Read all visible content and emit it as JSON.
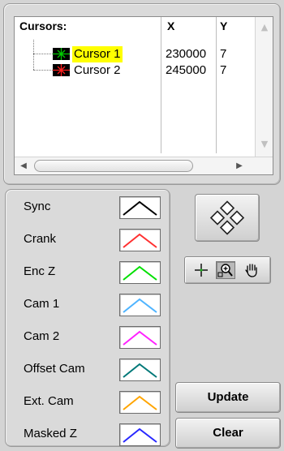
{
  "cursor_table": {
    "headers": {
      "name": "Cursors:",
      "x": "X",
      "y": "Y"
    },
    "rows": [
      {
        "name": "Cursor 1",
        "x": "230000",
        "y": "7",
        "color": "#00c800",
        "selected": true
      },
      {
        "name": "Cursor 2",
        "x": "245000",
        "y": "7",
        "color": "#ff2020",
        "selected": false
      }
    ]
  },
  "legend": {
    "items": [
      {
        "label": "Sync",
        "color": "#000000"
      },
      {
        "label": "Crank",
        "color": "#ff3030"
      },
      {
        "label": "Enc Z",
        "color": "#00e000"
      },
      {
        "label": "Cam 1",
        "color": "#4fb4ff"
      },
      {
        "label": "Cam 2",
        "color": "#ff20ff"
      },
      {
        "label": "Offset Cam",
        "color": "#007878"
      },
      {
        "label": "Ext. Cam",
        "color": "#ffa500"
      },
      {
        "label": "Masked Z",
        "color": "#2828ff"
      }
    ]
  },
  "buttons": {
    "update": "Update",
    "clear": "Clear"
  },
  "icons": {
    "nav": "diamond-navigation-icon",
    "tools": [
      "crosshair-cursor-icon",
      "zoom-icon",
      "hand-pan-icon"
    ]
  }
}
